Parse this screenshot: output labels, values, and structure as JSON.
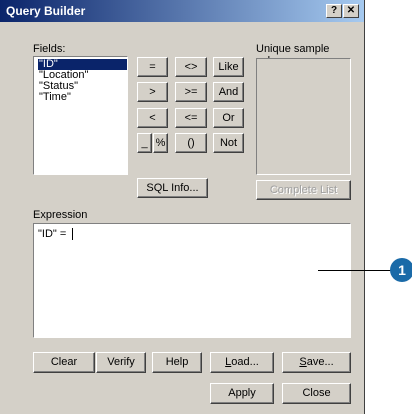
{
  "window": {
    "title": "Query Builder",
    "help_btn": "?",
    "close_btn": "✕"
  },
  "fields": {
    "label": "Fields:",
    "items": [
      "\"ID\"",
      "\"Location\"",
      "\"Status\"",
      "\"Time\""
    ],
    "selected_index": 0
  },
  "operators": {
    "row1": [
      "=",
      "<>",
      "Like"
    ],
    "row2": [
      ">",
      ">=",
      "And"
    ],
    "row3": [
      "<",
      "<=",
      "Or"
    ],
    "row4": [
      "_",
      "%",
      "()",
      "Not"
    ]
  },
  "sql_info": "SQL Info...",
  "unique": {
    "label": "Unique sample values",
    "complete_list": "Complete List"
  },
  "expression": {
    "label": "Expression",
    "value": "\"ID\" ="
  },
  "buttons": {
    "clear": "Clear",
    "verify": "Verify",
    "help": "Help",
    "load_u": "L",
    "load_rest": "oad...",
    "save_u": "S",
    "save_rest": "ave...",
    "apply": "Apply",
    "close": "Close"
  },
  "callout": "1"
}
